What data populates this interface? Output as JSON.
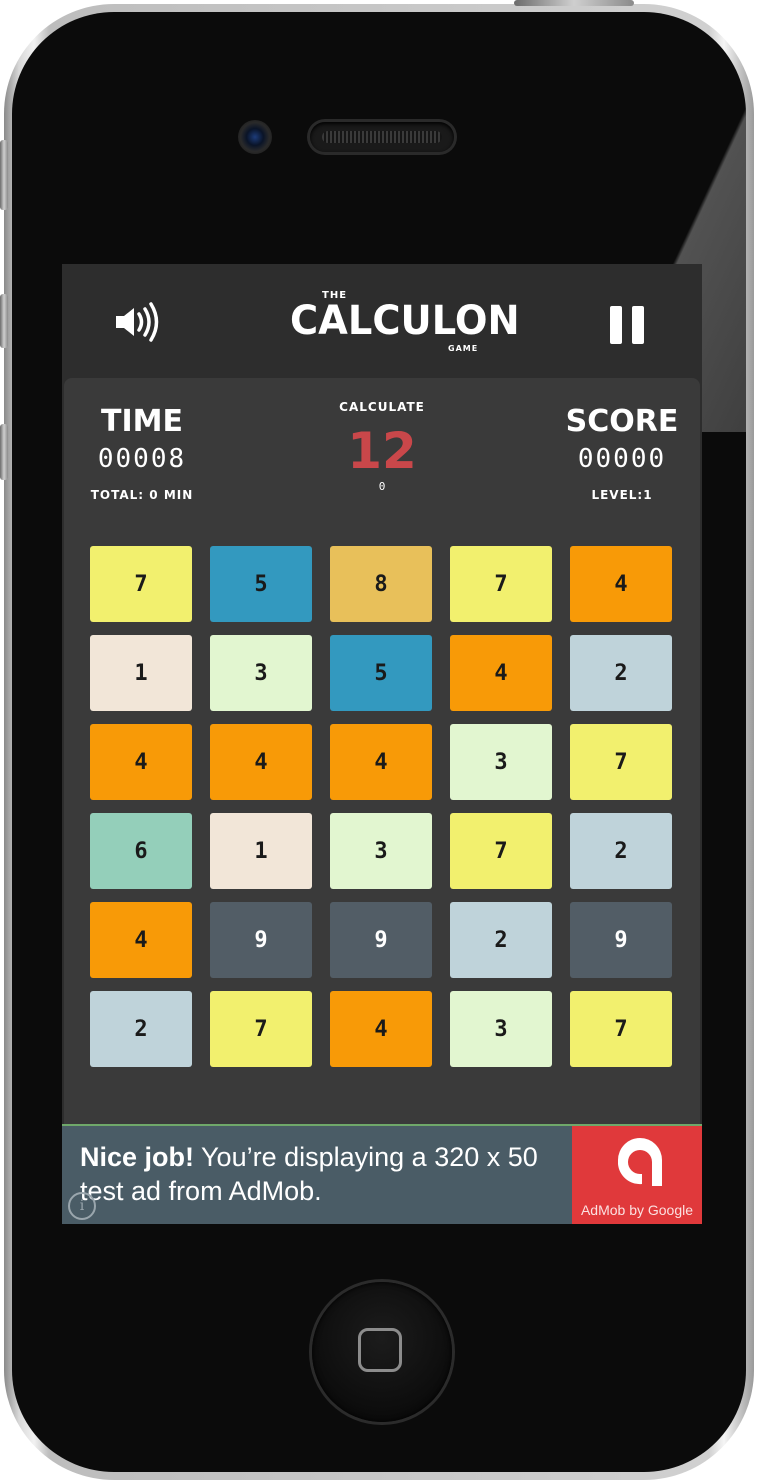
{
  "app": {
    "logo_the": "THE",
    "logo_main": "CALCULON",
    "logo_game": "GAME"
  },
  "stats": {
    "time_label": "TIME",
    "time_value": "00008",
    "total_label": "TOTAL: 0 MIN",
    "calc_label": "CALCULATE",
    "calc_target": "12",
    "calc_current": "0",
    "score_label": "SCORE",
    "score_value": "00000",
    "level_label": "LEVEL:1"
  },
  "icons": {
    "sound": "speaker-volume-icon",
    "pause": "pause-icon",
    "info": "info-icon",
    "admob": "admob-logo-icon"
  },
  "colors": {
    "screen_bg": "#2d2d2d",
    "panel_bg": "#3a3a3a",
    "target": "#c9474a",
    "tile_palette": {
      "1": "#f2e6d8",
      "2": "#bfd3da",
      "3": "#e2f6d0",
      "4": "#f89a07",
      "5": "#3399bf",
      "6": "#94cfba",
      "7": "#f2f06e",
      "8": "#e8c05a",
      "9": "#525d66"
    },
    "tile_text_dark": "#1a1a1a",
    "tile_text_light": "#ffffff"
  },
  "grid": [
    [
      "7",
      "5",
      "8",
      "7",
      "4"
    ],
    [
      "1",
      "3",
      "5",
      "4",
      "2"
    ],
    [
      "4",
      "4",
      "4",
      "3",
      "7"
    ],
    [
      "6",
      "1",
      "3",
      "7",
      "2"
    ],
    [
      "4",
      "9",
      "9",
      "2",
      "9"
    ],
    [
      "2",
      "7",
      "4",
      "3",
      "7"
    ]
  ],
  "ad": {
    "bold_text": "Nice job!",
    "text": " You’re displaying a 320 x 50 test ad from AdMob.",
    "brand": "AdMob by Google",
    "info_glyph": "i"
  }
}
